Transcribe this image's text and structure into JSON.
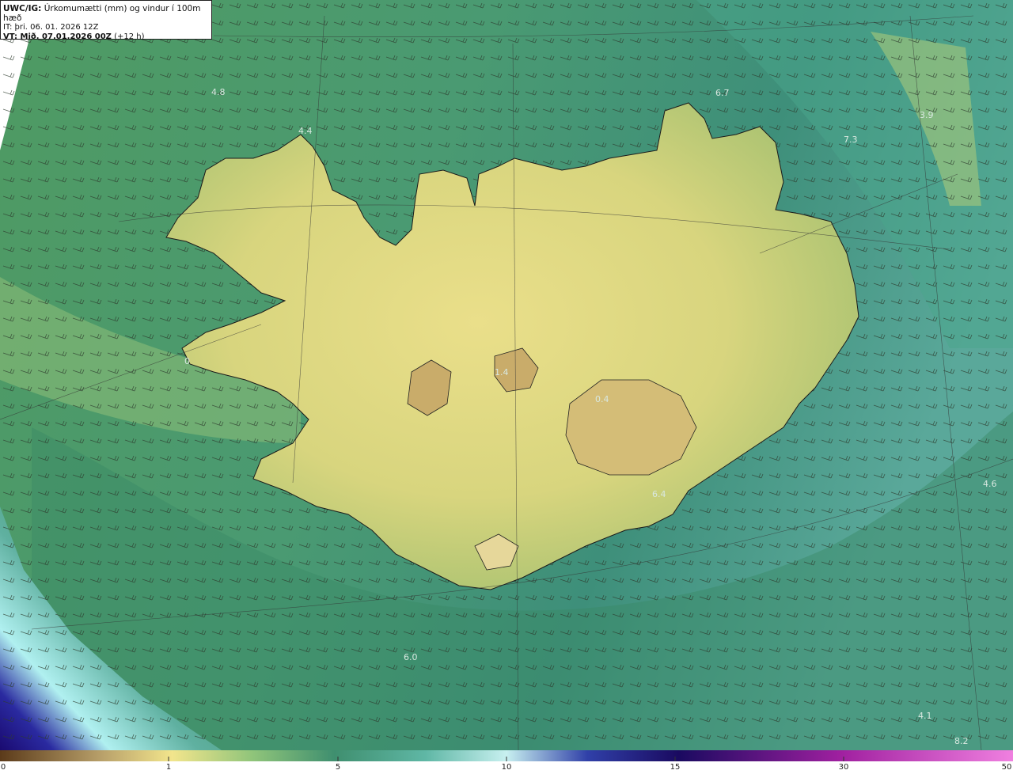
{
  "header": {
    "model_label": "UWC/IG:",
    "title": "Úrkomumætti (mm) og vindur í 100m hæð",
    "init_time": "IT: þri. 06. 01. 2026 12Z",
    "valid_prefix": "VT: Mið. 07.01.2026 00Z",
    "valid_suffix": "(+12 h)"
  },
  "map": {
    "labels": [
      "4.8",
      "4.4",
      "6.7",
      "3.9",
      "7.3",
      "4.6",
      "6.0",
      "4.1",
      "8.2",
      "0",
      "1.4",
      "0.4",
      "6.4"
    ]
  },
  "colorbar": {
    "ticks": [
      "0",
      "1",
      "5",
      "10",
      "15",
      "30",
      "50"
    ],
    "colors": [
      "#5b3a1a",
      "#b8a06a",
      "#f2e58c",
      "#8fc47a",
      "#3f8f6f",
      "#5fb7a5",
      "#c8f0f0",
      "#3040a8",
      "#1a0a60",
      "#a020a0",
      "#f080e0"
    ]
  }
}
